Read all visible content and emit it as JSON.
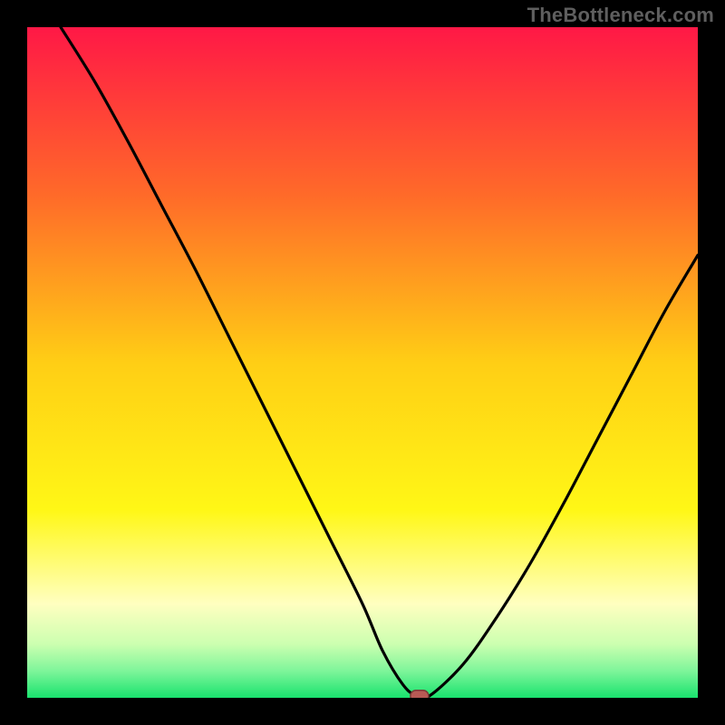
{
  "watermark": "TheBottleneck.com",
  "colors": {
    "page_bg": "#000000",
    "curve": "#000000",
    "marker_fill": "#b85a55",
    "marker_stroke": "#7b3b37",
    "watermark": "#5f5f5f",
    "gradient_stops": [
      {
        "offset": 0.0,
        "color": "#ff1846"
      },
      {
        "offset": 0.25,
        "color": "#ff6a29"
      },
      {
        "offset": 0.5,
        "color": "#ffce15"
      },
      {
        "offset": 0.72,
        "color": "#fff716"
      },
      {
        "offset": 0.86,
        "color": "#ffffc0"
      },
      {
        "offset": 0.92,
        "color": "#ccffb0"
      },
      {
        "offset": 0.96,
        "color": "#7ef59a"
      },
      {
        "offset": 1.0,
        "color": "#19e36e"
      }
    ]
  },
  "chart_data": {
    "type": "line",
    "title": "",
    "xlabel": "",
    "ylabel": "",
    "xlim": [
      0,
      100
    ],
    "ylim": [
      0,
      100
    ],
    "grid": false,
    "legend": false,
    "series": [
      {
        "name": "bottleneck-curve",
        "x": [
          5,
          10,
          15,
          20,
          25,
          30,
          35,
          40,
          45,
          50,
          53,
          56,
          58,
          60,
          65,
          70,
          75,
          80,
          85,
          90,
          95,
          100
        ],
        "y": [
          100,
          92,
          83,
          73.5,
          64,
          54,
          44,
          34,
          24,
          14,
          7,
          2,
          0.3,
          0.3,
          5,
          12,
          20,
          29,
          38.5,
          48,
          57.5,
          66
        ]
      }
    ],
    "marker": {
      "x": 58.5,
      "y": 0.3,
      "shape": "pill"
    }
  }
}
